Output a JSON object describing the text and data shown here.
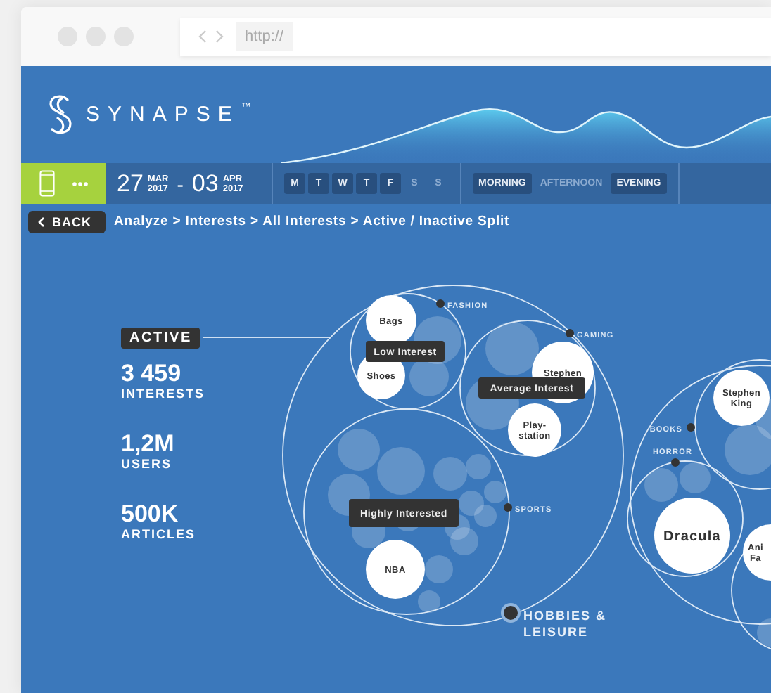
{
  "browser": {
    "url": "http://"
  },
  "header": {
    "brand": "SYNAPSE",
    "trademark": "™"
  },
  "filters": {
    "date_range": {
      "start": {
        "day": "27",
        "month": "MAR",
        "year": "2017"
      },
      "separator": "-",
      "end": {
        "day": "03",
        "month": "APR",
        "year": "2017"
      }
    },
    "days": [
      {
        "label": "M",
        "selected": true
      },
      {
        "label": "T",
        "selected": true
      },
      {
        "label": "W",
        "selected": true
      },
      {
        "label": "T",
        "selected": true
      },
      {
        "label": "F",
        "selected": true
      },
      {
        "label": "S",
        "selected": false
      },
      {
        "label": "S",
        "selected": false
      }
    ],
    "times": [
      {
        "label": "MORNING",
        "selected": true
      },
      {
        "label": "AFTERNOON",
        "selected": false
      },
      {
        "label": "EVENING",
        "selected": true
      }
    ]
  },
  "breadcrumb": {
    "back": "BACK",
    "path": "Analyze > Interests > All Interests > Active / Inactive Split"
  },
  "summary": {
    "tag": "ACTIVE",
    "stats": [
      {
        "value": "3 459",
        "label": "INTERESTS"
      },
      {
        "value": "1,2M",
        "label": "USERS"
      },
      {
        "value": "500K",
        "label": "ARTICLES"
      }
    ]
  },
  "bubble_chart": {
    "categories": [
      {
        "lines": [
          "FASHION"
        ]
      },
      {
        "lines": [
          "GAMING"
        ]
      },
      {
        "lines": [
          "SPORTS"
        ]
      },
      {
        "lines": [
          "HOBBIES &",
          "LEISURE"
        ]
      },
      {
        "lines": [
          "BOOKS"
        ]
      },
      {
        "lines": [
          "HORROR"
        ]
      }
    ],
    "bubbles": [
      {
        "lines": [
          "Bags"
        ]
      },
      {
        "lines": [
          "Shoes"
        ]
      },
      {
        "lines": [
          "Stephen"
        ]
      },
      {
        "lines": [
          "Play-",
          "station"
        ]
      },
      {
        "lines": [
          "NBA"
        ]
      },
      {
        "lines": [
          "Stephen",
          "King"
        ]
      },
      {
        "lines": [
          "Dracula"
        ]
      },
      {
        "lines": [
          "Ani",
          "Fa"
        ]
      }
    ],
    "tags": [
      "Low Interest",
      "Average Interest",
      "Highly Interested"
    ]
  }
}
